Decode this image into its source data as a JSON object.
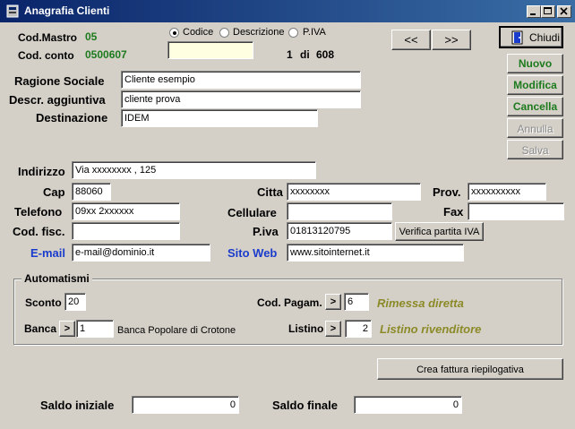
{
  "window": {
    "title": "Anagrafia Clienti"
  },
  "header": {
    "cod_mastro_label": "Cod.Mastro",
    "cod_mastro_value": "05",
    "cod_conto_label": "Cod. conto",
    "cod_conto_value": "0500607",
    "search_options": [
      "Codice",
      "Descrizione",
      "P.IVA"
    ],
    "search_selected": "Codice",
    "search_value": "",
    "record_pos": "1",
    "record_of": "di",
    "record_total": "608",
    "prev_label": "<<",
    "next_label": ">>",
    "close_label": "Chiudi"
  },
  "actions": {
    "nuovo": "Nuovo",
    "modifica": "Modifica",
    "cancella": "Cancella",
    "annulla": "Annulla",
    "salva": "Salva"
  },
  "form": {
    "ragione_sociale_label": "Ragione Sociale",
    "ragione_sociale": "Cliente esempio",
    "descr_label": "Descr. aggiuntiva",
    "descr": "cliente prova",
    "destinazione_label": "Destinazione",
    "destinazione": "IDEM",
    "indirizzo_label": "Indirizzo",
    "indirizzo": "Via xxxxxxxx , 125",
    "cap_label": "Cap",
    "cap": "88060",
    "citta_label": "Citta",
    "citta": "xxxxxxxx",
    "prov_label": "Prov.",
    "prov": "xxxxxxxxxx",
    "telefono_label": "Telefono",
    "telefono": "09xx 2xxxxxx",
    "cellulare_label": "Cellulare",
    "cellulare": "",
    "fax_label": "Fax",
    "fax": "",
    "codfisc_label": "Cod. fisc.",
    "codfisc": "",
    "piva_label": "P.iva",
    "piva": "01813120795",
    "verifica_label": "Verifica partita IVA",
    "email_label": "E-mail",
    "email": "e-mail@dominio.it",
    "sitoweb_label": "Sito Web",
    "sitoweb": "www.sitointernet.it"
  },
  "automatismi": {
    "title": "Automatismi",
    "sconto_label": "Sconto",
    "sconto": "20",
    "codpag_label": "Cod. Pagam.",
    "codpag": "6",
    "codpag_desc": "Rimessa diretta",
    "banca_label": "Banca",
    "banca": "1",
    "banca_desc": "Banca Popolare di Crotone",
    "listino_label": "Listino",
    "listino": "2",
    "listino_desc": "Listino rivenditore",
    "arrow_label": ">"
  },
  "crea_fattura_label": "Crea fattura riepilogativa",
  "saldo": {
    "iniziale_label": "Saldo iniziale",
    "iniziale": "0",
    "finale_label": "Saldo finale",
    "finale": "0"
  }
}
